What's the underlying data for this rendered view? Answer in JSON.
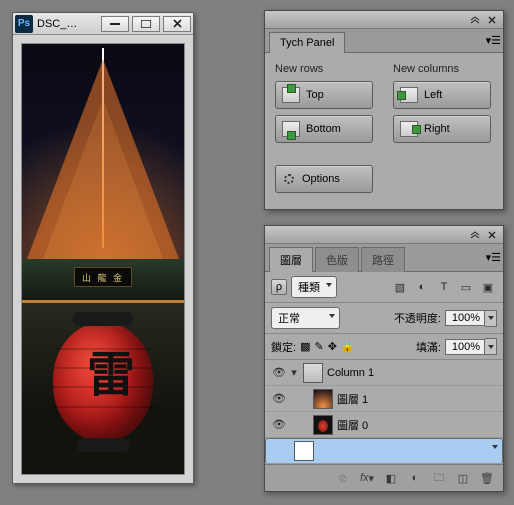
{
  "document": {
    "title": "DSC_…"
  },
  "tych": {
    "tab": "Tych Panel",
    "rows_header": "New rows",
    "cols_header": "New columns",
    "buttons": {
      "top": "Top",
      "bottom": "Bottom",
      "left": "Left",
      "right": "Right"
    },
    "options": "Options"
  },
  "layers": {
    "tabs": {
      "layers": "圖層",
      "channels": "色版",
      "paths": "路徑"
    },
    "kind_label": "種類",
    "blend_mode": "正常",
    "opacity_label": "不透明度:",
    "opacity_value": "100%",
    "lock_label": "鎖定:",
    "fill_label": "填滿:",
    "fill_value": "100%",
    "group_name": "Column 1",
    "layer1": "圖層 1",
    "layer0": "圖層 0",
    "sign_text": "山 龍 金"
  }
}
